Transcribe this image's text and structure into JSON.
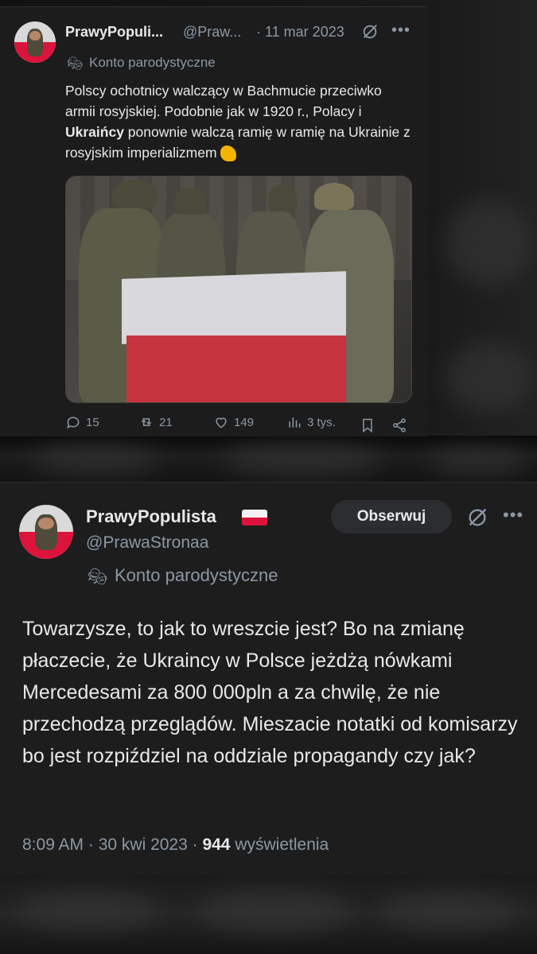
{
  "tweet1": {
    "display_name": "PrawyPopuli...",
    "handle": "@Praw...",
    "date": "· 11 mar 2023",
    "parody_label": "Konto parodystyczne",
    "text_before": "Polscy ochotnicy walczący w Bachmucie przeciwko armii rosyjskiej. Podobnie jak w 1920 r., Polacy i ",
    "text_bold": "Ukraińcy",
    "text_after": " ponownie walczą ramię w ramię na Ukrainie z rosyjskim imperializmem",
    "replies": "15",
    "reposts": "21",
    "likes": "149",
    "views": "3 tys."
  },
  "tweet2": {
    "display_name": "PrawyPopulista",
    "handle": "@PrawaStronaa",
    "follow_label": "Obserwuj",
    "parody_label": "Konto parodystyczne",
    "text": "Towarzysze, to jak to wreszcie jest? Bo na zmianę płaczecie, że Ukraincy w Polsce jeżdżą nówkami Mercedesami za 800 000pln a za chwilę, że nie przechodzą przeglądów. Mieszacie notatki od komisarzy bo jest rozpiździel na oddziale propagandy czy jak?",
    "time_date": "8:09 AM · 30 kwi 2023 · ",
    "views_count": "944",
    "views_label": " wyświetlenia"
  },
  "icons": {
    "parody": "theater-mask-icon",
    "grok": "grok-icon",
    "more": "more-icon",
    "reply": "reply-icon",
    "repost": "repost-icon",
    "like": "like-icon",
    "views": "views-icon",
    "bookmark": "bookmark-icon",
    "share": "share-icon"
  },
  "colors": {
    "background": "#1c1c1c",
    "text": "#e7e9ea",
    "muted": "#8b98a5",
    "flag_red": "#dc143c"
  }
}
